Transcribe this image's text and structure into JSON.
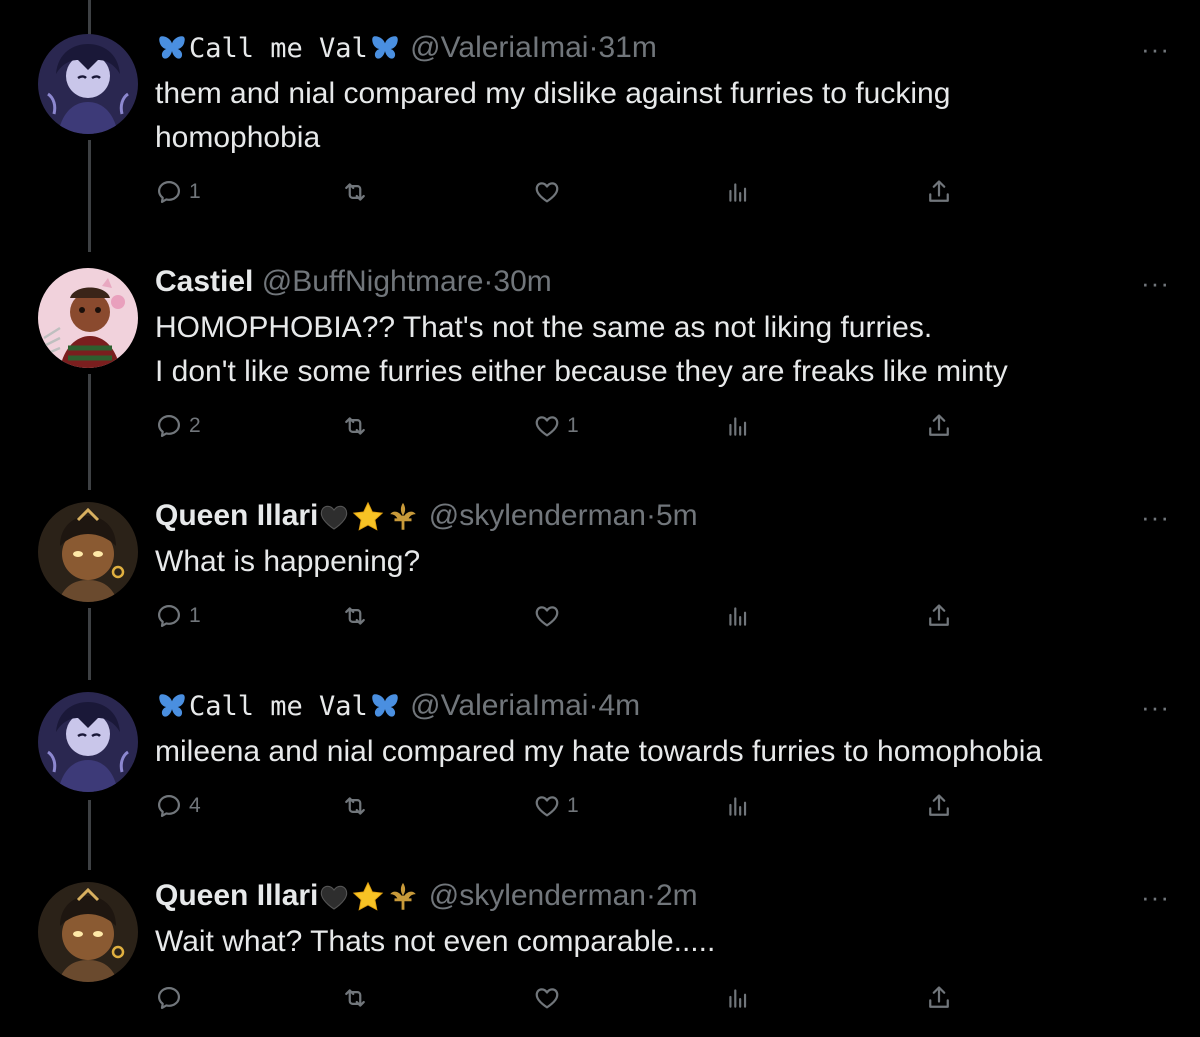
{
  "tweets": [
    {
      "name": "Call me Val",
      "handle": "@ValeriaImai",
      "sep": "·",
      "time": "31m",
      "text_lines": [
        "them and nial compared my dislike against furries to fucking",
        "homophobia"
      ],
      "reply_count": "1",
      "retweet_count": "",
      "like_count": "",
      "more": "···",
      "avatar": "anime-girl-avatar"
    },
    {
      "name": "Castiel",
      "handle": "@BuffNightmare",
      "sep": "·",
      "time": "30m",
      "text_lines": [
        "HOMOPHOBIA?? That's not the same as not liking furries.",
        "I don't like some furries either because they are freaks like minty"
      ],
      "reply_count": "2",
      "retweet_count": "",
      "like_count": "1",
      "more": "···",
      "avatar": "freddy-krueger-avatar"
    },
    {
      "name": "Queen Illari",
      "handle": "@skylenderman",
      "sep": "·",
      "time": "5m",
      "text_lines": [
        "What is happening?"
      ],
      "reply_count": "1",
      "retweet_count": "",
      "like_count": "",
      "more": "···",
      "avatar": "illari-avatar"
    },
    {
      "name": "Call me Val",
      "handle": "@ValeriaImai",
      "sep": "·",
      "time": "4m",
      "text_lines": [
        "mileena and nial compared my hate towards furries to homophobia"
      ],
      "reply_count": "4",
      "retweet_count": "",
      "like_count": "1",
      "more": "···",
      "avatar": "anime-girl-avatar"
    },
    {
      "name": "Queen Illari",
      "handle": "@skylenderman",
      "sep": "·",
      "time": "2m",
      "text_lines": [
        "Wait what? Thats not even comparable....."
      ],
      "reply_count": "",
      "retweet_count": "",
      "like_count": "",
      "more": "···",
      "avatar": "illari-avatar"
    }
  ],
  "colors": {
    "background": "#000000",
    "text": "#e7e9ea",
    "muted": "#71767b",
    "thread_line": "#3e4144",
    "butterfly": "#4a8fe0"
  }
}
